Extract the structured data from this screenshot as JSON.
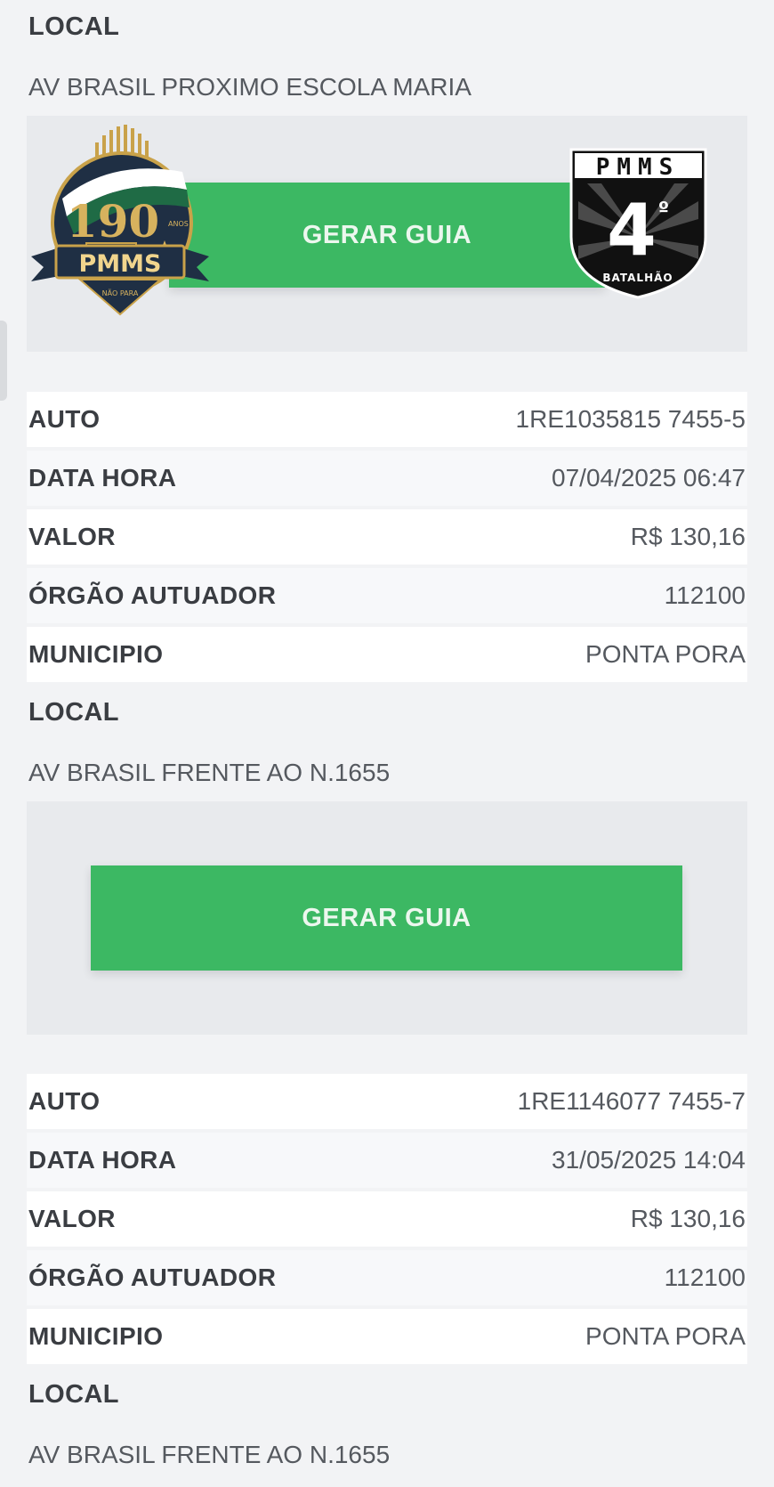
{
  "header": {
    "local_label": "LOCAL",
    "local_value": "AV BRASIL PROXIMO ESCOLA MARIA"
  },
  "button_label": "GERAR GUIA",
  "logos": {
    "left_number": "190",
    "left_sub": "ANOS",
    "left_name": "PMMS",
    "left_motto": "NÃO PARA",
    "right_title": "PMMS",
    "right_number": "4",
    "right_degree": "º",
    "right_caption": "BATALHÃO"
  },
  "records": [
    {
      "auto_label": "AUTO",
      "auto": "1RE1035815 7455-5",
      "datahora_label": "DATA HORA",
      "datahora": "07/04/2025 06:47",
      "valor_label": "VALOR",
      "valor": "R$ 130,16",
      "orgao_label": "ÓRGÃO AUTUADOR",
      "orgao": "112100",
      "municipio_label": "MUNICIPIO",
      "municipio": "PONTA PORA",
      "local_label": "LOCAL",
      "local": "AV BRASIL FRENTE AO N.1655"
    },
    {
      "auto_label": "AUTO",
      "auto": "1RE1146077 7455-7",
      "datahora_label": "DATA HORA",
      "datahora": "31/05/2025 14:04",
      "valor_label": "VALOR",
      "valor": "R$ 130,16",
      "orgao_label": "ÓRGÃO AUTUADOR",
      "orgao": "112100",
      "municipio_label": "MUNICIPIO",
      "municipio": "PONTA PORA",
      "local_label": "LOCAL",
      "local": "AV BRASIL FRENTE AO N.1655"
    }
  ],
  "colors": {
    "button": "#3cb863",
    "panel": "#e8eaed",
    "shield_dark": "#1f2f44",
    "shield_green": "#1f6b45"
  }
}
